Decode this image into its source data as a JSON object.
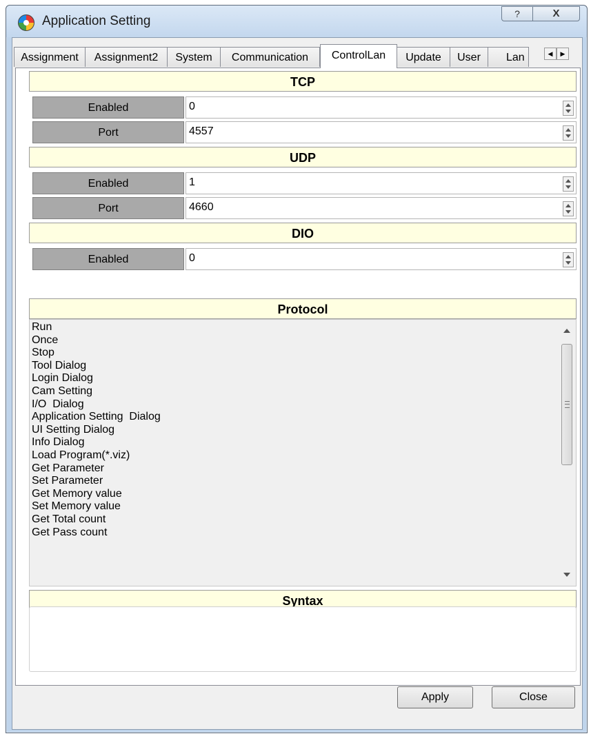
{
  "window": {
    "title": "Application Setting"
  },
  "titlebar": {
    "help_label": "?",
    "close_label": "X"
  },
  "tabs": [
    "Assignment",
    "Assignment2",
    "System",
    "Communication",
    "ControlLan",
    "Update",
    "User",
    "Lan"
  ],
  "sections": {
    "tcp": {
      "header": "TCP",
      "enabled_label": "Enabled",
      "enabled_value": "0",
      "port_label": "Port",
      "port_value": "4557"
    },
    "udp": {
      "header": "UDP",
      "enabled_label": "Enabled",
      "enabled_value": "1",
      "port_label": "Port",
      "port_value": "4660"
    },
    "dio": {
      "header": "DIO",
      "enabled_label": "Enabled",
      "enabled_value": "0"
    }
  },
  "protocol": {
    "header": "Protocol",
    "items": [
      "Run",
      "Once",
      "Stop",
      "Tool Dialog",
      "Login Dialog",
      "Cam Setting",
      "I/O  Dialog",
      "Application Setting  Dialog",
      "UI Setting Dialog",
      "Info Dialog",
      "Load Program(*.viz)",
      "Get Parameter",
      "Set Parameter",
      "Get Memory value",
      "Set Memory value",
      "Get Total count",
      "Get Pass count"
    ]
  },
  "syntax": {
    "header": "Syntax"
  },
  "buttons": {
    "apply": "Apply",
    "close": "Close"
  }
}
